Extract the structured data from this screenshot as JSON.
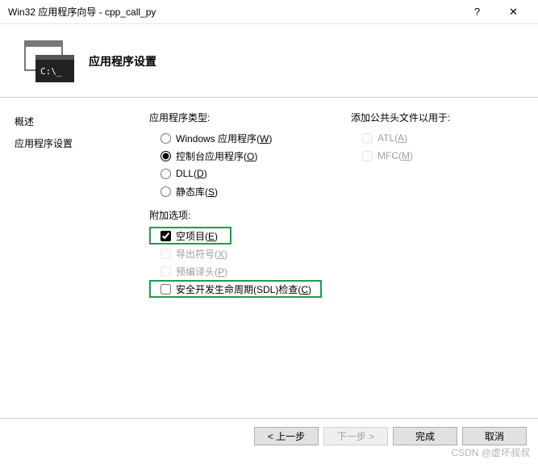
{
  "window": {
    "title": "Win32 应用程序向导 - cpp_call_py",
    "help": "?",
    "close": "✕"
  },
  "header": {
    "title": "应用程序设置",
    "icon_prompt": "C:\\_"
  },
  "sidebar": {
    "items": [
      {
        "label": "概述"
      },
      {
        "label": "应用程序设置"
      }
    ]
  },
  "content": {
    "app_type": {
      "label": "应用程序类型:",
      "options": [
        {
          "text": "Windows 应用程序(",
          "accel": "W",
          "suffix": ")",
          "checked": false
        },
        {
          "text": "控制台应用程序(",
          "accel": "O",
          "suffix": ")",
          "checked": true
        },
        {
          "text": "DLL(",
          "accel": "D",
          "suffix": ")",
          "checked": false
        },
        {
          "text": "静态库(",
          "accel": "S",
          "suffix": ")",
          "checked": false
        }
      ]
    },
    "extra": {
      "label": "附加选项:",
      "options": [
        {
          "text": "空项目(",
          "accel": "E",
          "suffix": ")",
          "checked": true,
          "disabled": false,
          "highlight": true
        },
        {
          "text": "导出符号(",
          "accel": "X",
          "suffix": ")",
          "checked": false,
          "disabled": true,
          "highlight": false
        },
        {
          "text": "预编译头(",
          "accel": "P",
          "suffix": ")",
          "checked": false,
          "disabled": true,
          "highlight": false
        },
        {
          "text": "安全开发生命周期(SDL)检查(",
          "accel": "C",
          "suffix": ")",
          "checked": false,
          "disabled": false,
          "highlight": true
        }
      ]
    },
    "headers": {
      "label": "添加公共头文件以用于:",
      "options": [
        {
          "text": "ATL(",
          "accel": "A",
          "suffix": ")",
          "checked": false,
          "disabled": true
        },
        {
          "text": "MFC(",
          "accel": "M",
          "suffix": ")",
          "checked": false,
          "disabled": true
        }
      ]
    }
  },
  "footer": {
    "prev": "< 上一步",
    "next": "下一步 >",
    "finish": "完成",
    "cancel": "取消"
  },
  "watermark": "CSDN @虚坏叔叔"
}
